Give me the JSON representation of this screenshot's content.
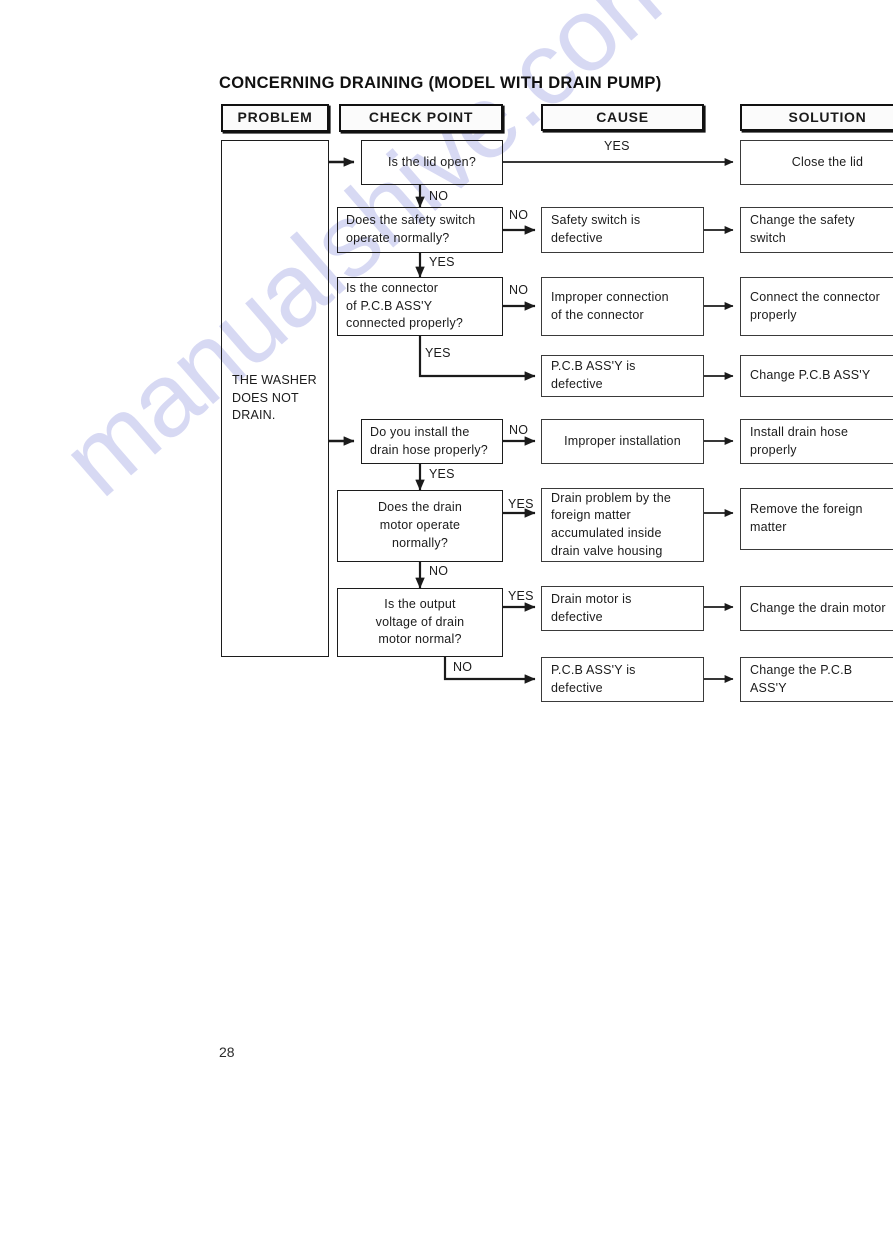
{
  "document": {
    "title": "CONCERNING DRAINING (MODEL WITH DRAIN PUMP)",
    "page_number": "28",
    "watermark": "manualshive.com"
  },
  "columns": {
    "problem": "PROBLEM",
    "check_point": "CHECK POINT",
    "cause": "CAUSE",
    "solution": "SOLUTION"
  },
  "problem": {
    "text": "THE WASHER\nDOES NOT\nDRAIN."
  },
  "checks": {
    "lid": "Is the lid open?",
    "safety_switch": "Does the safety switch\noperate normally?",
    "connector": "Is the connector\nof P.C.B ASS'Y\nconnected properly?",
    "drain_hose": "Do you install the\ndrain hose properly?",
    "drain_motor": "Does the drain\nmotor operate\nnormally?",
    "output_voltage": "Is the output\nvoltage of drain\nmotor normal?"
  },
  "causes": {
    "safety_switch_defective": "Safety switch is\ndefective",
    "improper_connection": "Improper connection\nof the connector",
    "pcb_defective_1": "P.C.B ASS'Y is\ndefective",
    "improper_installation": "Improper installation",
    "foreign_matter": "Drain problem by the\nforeign matter\naccumulated inside\ndrain valve housing",
    "drain_motor_defective": "Drain motor is\ndefective",
    "pcb_defective_2": "P.C.B ASS'Y is\ndefective"
  },
  "solutions": {
    "close_lid": "Close the lid",
    "change_safety_switch": "Change the safety\nswitch",
    "connect_connector": "Connect the connector\nproperly",
    "change_pcb_1": "Change P.C.B ASS'Y",
    "install_drain_hose": "Install drain hose\nproperly",
    "remove_foreign_matter": "Remove the foreign\nmatter",
    "change_drain_motor": "Change the drain motor",
    "change_pcb_2": "Change the P.C.B\nASS'Y"
  },
  "edge_labels": {
    "lid_yes": "YES",
    "lid_no": "NO",
    "safety_no": "NO",
    "safety_yes": "YES",
    "connector_no": "NO",
    "connector_yes": "YES",
    "hose_no": "NO",
    "hose_yes": "YES",
    "motor_yes": "YES",
    "motor_no": "NO",
    "voltage_yes": "YES",
    "voltage_no": "NO"
  }
}
